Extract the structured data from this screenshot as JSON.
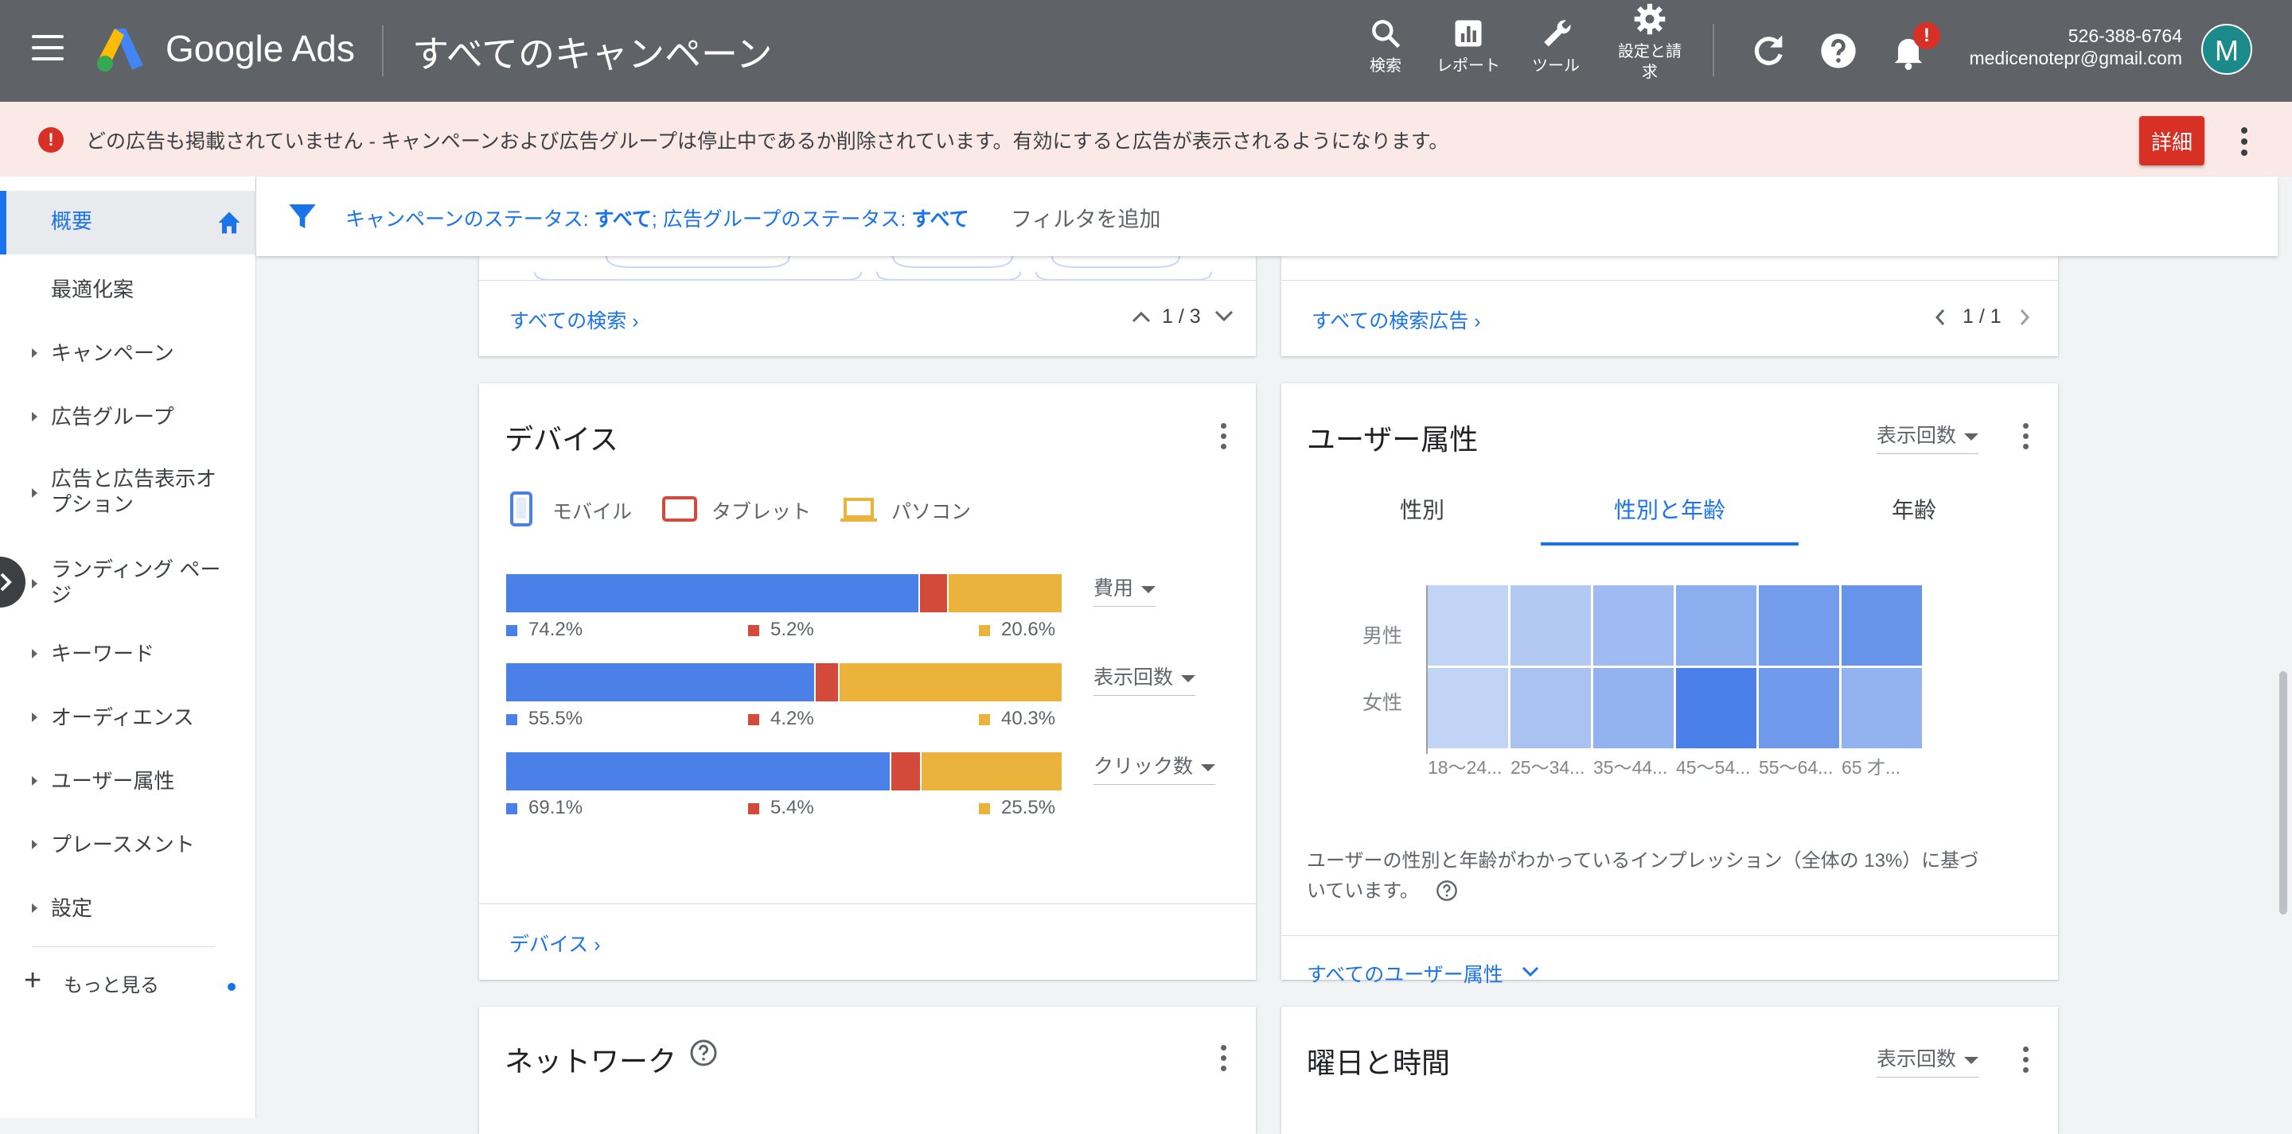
{
  "topbar": {
    "product_name": "Google Ads",
    "page_title": "すべてのキャンペーン",
    "tools": [
      {
        "icon": "search-icon",
        "label": "検索"
      },
      {
        "icon": "reports-icon",
        "label": "レポート"
      },
      {
        "icon": "wrench-icon",
        "label": "ツール"
      },
      {
        "icon": "gear-icon",
        "label": "設定と請\n求"
      }
    ],
    "notification_badge": "!",
    "account_id": "526-388-6764",
    "account_email": "medicenotepr@gmail.com",
    "avatar_letter": "M"
  },
  "alert": {
    "text": "どの広告も掲載されていません - キャンペーンおよび広告グループは停止中であるか削除されています。有効にすると広告が表示されるようになります。",
    "detail_button": "詳細",
    "color": "#d93025"
  },
  "sidebar": {
    "items": [
      {
        "label": "概要"
      },
      {
        "label": "最適化案"
      },
      {
        "label": "キャンペーン"
      },
      {
        "label": "広告グループ"
      },
      {
        "label": "広告と広告表示オ\nプション"
      },
      {
        "label": "ランディング ペー\nジ"
      },
      {
        "label": "キーワード"
      },
      {
        "label": "オーディエンス"
      },
      {
        "label": "ユーザー属性"
      },
      {
        "label": "プレースメント"
      },
      {
        "label": "設定"
      }
    ],
    "more_label": "もっと見る"
  },
  "filter": {
    "campaign_status_label": "キャンペーンのステータス: ",
    "campaign_status_value": "すべて",
    "separator": "; ",
    "adgroup_status_label": "広告グループのステータス: ",
    "adgroup_status_value": "すべて",
    "add_filter": "フィルタを追加"
  },
  "searches_card": {
    "link": "すべての検索",
    "pager": "1 / 3"
  },
  "search_ads_card": {
    "link": "すべての検索広告",
    "pager": "1 / 1"
  },
  "devices_card": {
    "title": "デバイス",
    "legend": [
      {
        "label": "モバイル",
        "color": "#4a80e8",
        "icon": "mobile-icon"
      },
      {
        "label": "タブレット",
        "color": "#d44a3a",
        "icon": "tablet-icon"
      },
      {
        "label": "パソコン",
        "color": "#ebb33c",
        "icon": "laptop-icon"
      }
    ],
    "rows": [
      {
        "metric": "費用",
        "mobile": "74.2%",
        "tablet": "5.2%",
        "pc": "20.6%"
      },
      {
        "metric": "表示回数",
        "mobile": "55.5%",
        "tablet": "4.2%",
        "pc": "40.3%"
      },
      {
        "metric": "クリック数",
        "mobile": "69.1%",
        "tablet": "5.4%",
        "pc": "25.5%"
      }
    ],
    "link": "デバイス"
  },
  "demographics_card": {
    "title": "ユーザー属性",
    "metric_dropdown": "表示回数",
    "tabs": [
      "性別",
      "性別と年齢",
      "年齢"
    ],
    "active_tab": 1,
    "rows": [
      "男性",
      "女性"
    ],
    "age_labels": [
      "18〜24...",
      "25〜34...",
      "35〜44...",
      "45〜54...",
      "55〜64...",
      "65 才..."
    ],
    "heat_male": [
      0.18,
      0.28,
      0.42,
      0.55,
      0.72,
      0.8
    ],
    "heat_female": [
      0.18,
      0.35,
      0.5,
      1.0,
      0.75,
      0.5
    ],
    "note": "ユーザーの性別と年齢がわかっているインプレッション（全体の 13%）に基づ\nいています。",
    "link": "すべてのユーザー属性"
  },
  "network_card": {
    "title": "ネットワーク"
  },
  "schedule_card": {
    "title": "曜日と時間",
    "metric_dropdown": "表示回数"
  }
}
